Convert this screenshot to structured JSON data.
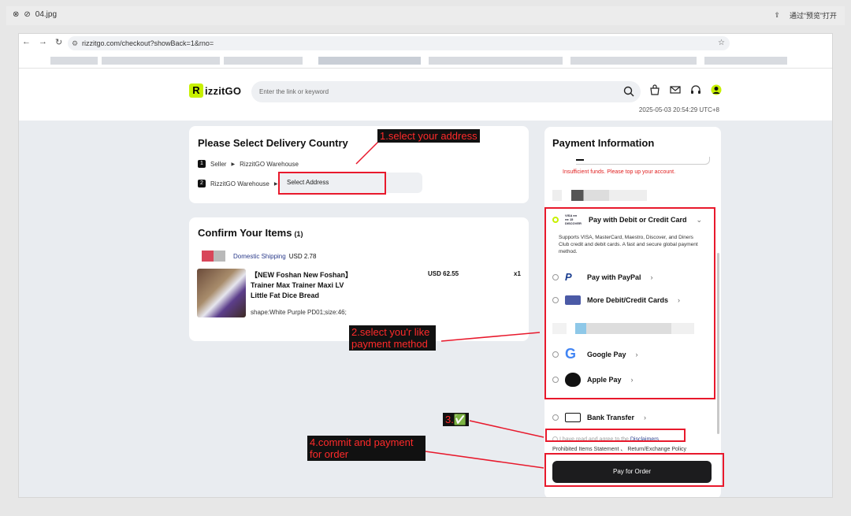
{
  "viewer": {
    "filename": "04.jpg",
    "open_with": "通过“预览”打开"
  },
  "browser": {
    "url": "rizzitgo.com/checkout?showBack=1&rno="
  },
  "header": {
    "logo_text": "izzitGO",
    "search_placeholder": "Enter the link or keyword",
    "datetime": "2025-05-03 20:54:29 UTC+8"
  },
  "delivery": {
    "title": "Please Select Delivery Country",
    "steps": [
      {
        "num": "1",
        "from": "Seller",
        "to": "RizzitGO Warehouse"
      },
      {
        "num": "2",
        "from": "RizzitGO Warehouse",
        "to": "Select Address"
      }
    ]
  },
  "items": {
    "title": "Confirm Your Items",
    "count": "(1)",
    "shipping_label": "Domestic Shipping",
    "shipping_price": "USD 2.78",
    "product": {
      "title": "【NEW Foshan New Foshan】 Trainer Max Trainer Maxi LV Little Fat Dice Bread",
      "price": "USD 62.55",
      "qty": "x1",
      "spec": "shape:White Purple PD01;size:46;"
    }
  },
  "payment": {
    "title": "Payment Information",
    "insufficient": "Insufficient funds. Please top up your account.",
    "options": [
      {
        "label": "Pay with Debit or Credit Card",
        "selected": true
      },
      {
        "label": "Pay with PayPal",
        "selected": false
      },
      {
        "label": "More Debit/Credit Cards",
        "selected": false
      },
      {
        "label": "Google Pay",
        "selected": false
      },
      {
        "label": "Apple Pay",
        "selected": false
      },
      {
        "label": "Bank Transfer",
        "selected": false
      }
    ],
    "card_description": "Supports VISA, MasterCard, Maestro, Discover, and Diners Club credit and debit cards. A fast and secure global payment method.",
    "agree_text": "I have read and agree to the",
    "disclaimers": "Disclaimers",
    "policies": "Prohibited Items Statement 、 Return/Exchange Policy",
    "pay_button": "Pay for Order"
  },
  "annotations": {
    "step1": "1.select your address",
    "step2": "2.select you'r like payment method",
    "step3": "3.✅",
    "step4": "4.commit and payment for order"
  },
  "colors": {
    "accent": "#c7f000",
    "annotation": "#e8192c",
    "button": "#1c1c1e"
  }
}
